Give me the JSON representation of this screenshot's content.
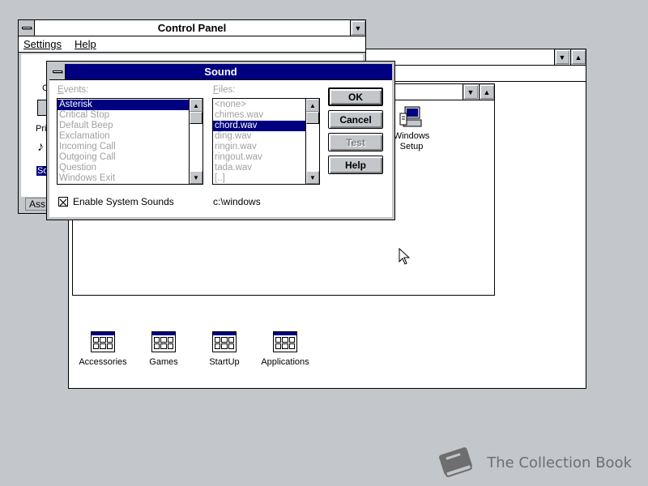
{
  "control_panel": {
    "title": "Control Panel",
    "menu": [
      "Settings",
      "Help"
    ],
    "partial_labels": [
      "C",
      "Prin",
      "So",
      "Ass"
    ]
  },
  "program_manager": {
    "groups": [
      {
        "label": "Accessories"
      },
      {
        "label": "Games"
      },
      {
        "label": "StartUp"
      },
      {
        "label": "Applications"
      }
    ],
    "main_group_icons": [
      {
        "label": "Windows Setup"
      }
    ]
  },
  "sound_dialog": {
    "title": "Sound",
    "events_label": "Events:",
    "files_label": "Files:",
    "events": [
      "Asterisk",
      "Critical Stop",
      "Default Beep",
      "Exclamation",
      "Incoming Call",
      "Outgoing Call",
      "Question",
      "Windows Exit"
    ],
    "events_selected": "Asterisk",
    "files": [
      "<none>",
      "chimes.wav",
      "chord.wav",
      "ding.wav",
      "ringin.wav",
      "ringout.wav",
      "tada.wav",
      "[..]"
    ],
    "files_selected": "chord.wav",
    "enable_label": "Enable System Sounds",
    "enable_checked": true,
    "path": "c:\\windows",
    "buttons": {
      "ok": "OK",
      "cancel": "Cancel",
      "test": "Test",
      "help": "Help"
    }
  },
  "watermark": {
    "text": "The Collection Book"
  }
}
